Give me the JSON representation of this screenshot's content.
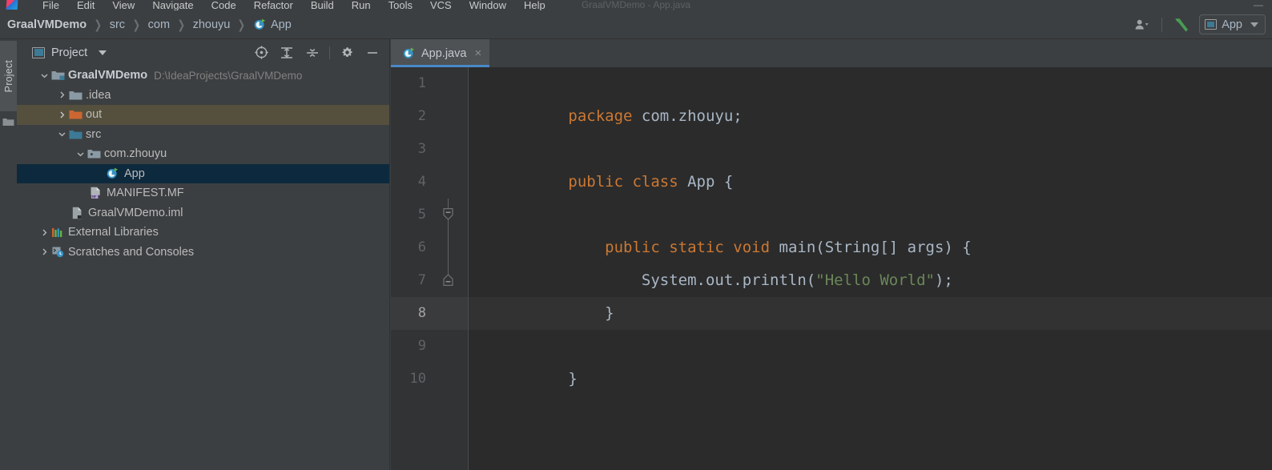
{
  "window": {
    "title": "GraalVMDemo - App.java",
    "min_label": "—",
    "max_label": "□",
    "close_label": "✕"
  },
  "menubar": {
    "items": [
      {
        "label": "File"
      },
      {
        "label": "Edit"
      },
      {
        "label": "View"
      },
      {
        "label": "Navigate"
      },
      {
        "label": "Code"
      },
      {
        "label": "Refactor"
      },
      {
        "label": "Build"
      },
      {
        "label": "Run"
      },
      {
        "label": "Tools"
      },
      {
        "label": "VCS"
      },
      {
        "label": "Window"
      },
      {
        "label": "Help"
      }
    ]
  },
  "breadcrumb": {
    "separator": "›",
    "items": [
      {
        "label": "GraalVMDemo",
        "bold": true,
        "icon": ""
      },
      {
        "label": "src",
        "bold": false,
        "icon": ""
      },
      {
        "label": "com",
        "bold": false,
        "icon": ""
      },
      {
        "label": "zhouyu",
        "bold": false,
        "icon": ""
      },
      {
        "label": "App",
        "bold": false,
        "icon": "java-class-runnable-icon"
      }
    ]
  },
  "navbar_right": {
    "account_icon": "person-icon",
    "account_chevron": "chevron-down-icon",
    "build_icon": "hammer-icon",
    "run_config": {
      "label": "App",
      "icon": "run-config-icon",
      "chevron": "chevron-down-icon"
    }
  },
  "toolstrip": {
    "project_label": "Project",
    "folder_icon": "folder-icon"
  },
  "project_panel": {
    "title": "Project",
    "title_icon": "project-view-icon",
    "title_chevron": "chevron-down-icon",
    "tools": [
      {
        "name": "select-opened-file-icon",
        "label": "Select Opened File"
      },
      {
        "name": "expand-all-icon",
        "label": "Expand All"
      },
      {
        "name": "collapse-all-icon",
        "label": "Collapse All"
      },
      {
        "name": "gear-icon",
        "label": "Settings"
      },
      {
        "name": "hide-icon",
        "label": "Hide"
      }
    ],
    "tree": [
      {
        "label": "GraalVMDemo",
        "path": "D:\\IdeaProjects\\GraalVMDemo",
        "icon": "project-root-folder-icon",
        "indent": 0,
        "arrow": "expanded",
        "bold": true,
        "state": "normal"
      },
      {
        "label": ".idea",
        "path": "",
        "icon": "folder-icon",
        "indent": 1,
        "arrow": "collapsed",
        "bold": false,
        "state": "normal"
      },
      {
        "label": "out",
        "path": "",
        "icon": "folder-excluded-icon",
        "indent": 1,
        "arrow": "collapsed",
        "bold": false,
        "state": "highlight-out"
      },
      {
        "label": "src",
        "path": "",
        "icon": "source-folder-icon",
        "indent": 1,
        "arrow": "expanded",
        "bold": false,
        "state": "normal"
      },
      {
        "label": "com.zhouyu",
        "path": "",
        "icon": "package-icon",
        "indent": 2,
        "arrow": "expanded",
        "bold": false,
        "state": "normal"
      },
      {
        "label": "App",
        "path": "",
        "icon": "java-class-runnable-icon",
        "indent": 3,
        "arrow": "none",
        "bold": false,
        "state": "selected"
      },
      {
        "label": "MANIFEST.MF",
        "path": "",
        "icon": "manifest-file-icon",
        "indent": 2,
        "arrow": "none",
        "bold": false,
        "state": "normal"
      },
      {
        "label": "GraalVMDemo.iml",
        "path": "",
        "icon": "iml-file-icon",
        "indent": 1,
        "arrow": "none",
        "bold": false,
        "state": "normal"
      },
      {
        "label": "External Libraries",
        "path": "",
        "icon": "libraries-icon",
        "indent": 0,
        "arrow": "collapsed",
        "bold": false,
        "state": "normal"
      },
      {
        "label": "Scratches and Consoles",
        "path": "",
        "icon": "scratches-icon",
        "indent": 0,
        "arrow": "collapsed",
        "bold": false,
        "state": "normal"
      }
    ]
  },
  "editor": {
    "tabs": [
      {
        "label": "App.java",
        "icon": "java-class-runnable-icon",
        "close": "×",
        "active": true
      }
    ],
    "caret_line": 8,
    "line_numbers": [
      "1",
      "2",
      "3",
      "4",
      "5",
      "6",
      "7",
      "8",
      "9",
      "10"
    ],
    "code_lines": [
      {
        "n": "1",
        "tokens": [
          {
            "t": "package",
            "c": "kw"
          },
          {
            "t": " com.zhouyu;",
            "c": "txt"
          }
        ]
      },
      {
        "n": "2",
        "tokens": []
      },
      {
        "n": "3",
        "tokens": [
          {
            "t": "public class",
            "c": "kw"
          },
          {
            "t": " App {",
            "c": "txt"
          }
        ]
      },
      {
        "n": "4",
        "tokens": []
      },
      {
        "n": "5",
        "tokens": [
          {
            "t": "    public static void",
            "c": "kw"
          },
          {
            "t": " main(String[] args) {",
            "c": "txt"
          }
        ]
      },
      {
        "n": "6",
        "tokens": [
          {
            "t": "        System.out.println(",
            "c": "txt"
          },
          {
            "t": "\"Hello World\"",
            "c": "str"
          },
          {
            "t": ");",
            "c": "txt"
          }
        ]
      },
      {
        "n": "7",
        "tokens": [
          {
            "t": "    }",
            "c": "txt"
          }
        ]
      },
      {
        "n": "8",
        "tokens": []
      },
      {
        "n": "9",
        "tokens": [
          {
            "t": "}",
            "c": "txt"
          }
        ]
      },
      {
        "n": "10",
        "tokens": []
      }
    ],
    "fold_markers": [
      {
        "line": 5,
        "type": "fold-open"
      },
      {
        "line": 7,
        "type": "fold-end"
      }
    ]
  },
  "colors": {
    "background": "#3c3f41",
    "editor_background": "#2b2b2b",
    "gutter_background": "#313335",
    "keyword": "#cc7832",
    "string": "#6a8759",
    "text": "#a9b7c6",
    "selection": "#0d293e",
    "excluded_highlight": "#55503d",
    "tab_indicator": "#4a88c7",
    "folder_excluded": "#cc6633",
    "folder": "#8a9aa5",
    "source_folder": "#3c7a95"
  }
}
